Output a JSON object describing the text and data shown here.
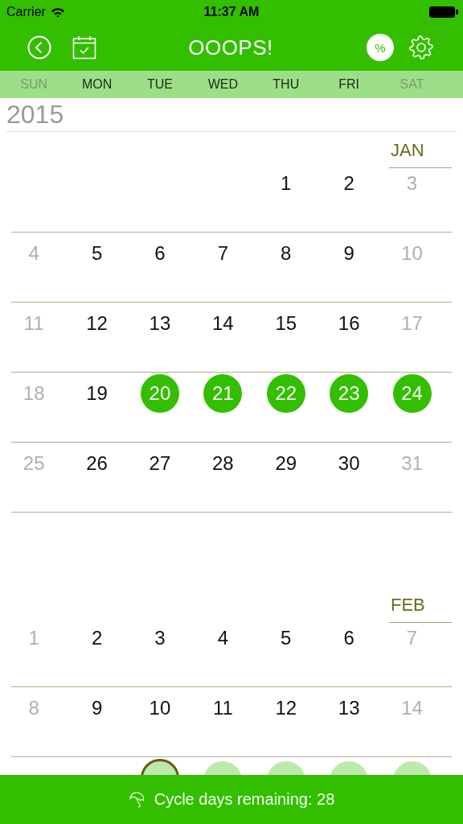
{
  "status_bar": {
    "carrier": "Carrier",
    "time": "11:37 AM"
  },
  "nav": {
    "title": "OOOPS!",
    "badge": "%"
  },
  "weekdays": [
    {
      "label": "SUN",
      "weekend": true
    },
    {
      "label": "MON",
      "weekend": false
    },
    {
      "label": "TUE",
      "weekend": false
    },
    {
      "label": "WED",
      "weekend": false
    },
    {
      "label": "THU",
      "weekend": false
    },
    {
      "label": "FRI",
      "weekend": false
    },
    {
      "label": "SAT",
      "weekend": true
    }
  ],
  "year": "2015",
  "months": [
    {
      "name": "JAN",
      "weeks": [
        [
          {
            "kind": "blank"
          },
          {
            "kind": "blank"
          },
          {
            "kind": "blank"
          },
          {
            "kind": "blank"
          },
          {
            "kind": "day",
            "day": "1",
            "weekend": false
          },
          {
            "kind": "day",
            "day": "2",
            "weekend": false
          },
          {
            "kind": "day",
            "day": "3",
            "weekend": true
          }
        ],
        [
          {
            "kind": "day",
            "day": "4",
            "weekend": true
          },
          {
            "kind": "day",
            "day": "5",
            "weekend": false
          },
          {
            "kind": "day",
            "day": "6",
            "weekend": false
          },
          {
            "kind": "day",
            "day": "7",
            "weekend": false
          },
          {
            "kind": "day",
            "day": "8",
            "weekend": false
          },
          {
            "kind": "day",
            "day": "9",
            "weekend": false
          },
          {
            "kind": "day",
            "day": "10",
            "weekend": true
          }
        ],
        [
          {
            "kind": "day",
            "day": "11",
            "weekend": true
          },
          {
            "kind": "day",
            "day": "12",
            "weekend": false
          },
          {
            "kind": "day",
            "day": "13",
            "weekend": false
          },
          {
            "kind": "day",
            "day": "14",
            "weekend": false
          },
          {
            "kind": "day",
            "day": "15",
            "weekend": false
          },
          {
            "kind": "day",
            "day": "16",
            "weekend": false
          },
          {
            "kind": "day",
            "day": "17",
            "weekend": true
          }
        ],
        [
          {
            "kind": "day",
            "day": "18",
            "weekend": true
          },
          {
            "kind": "day",
            "day": "19",
            "weekend": false
          },
          {
            "kind": "period",
            "day": "20"
          },
          {
            "kind": "period",
            "day": "21"
          },
          {
            "kind": "period",
            "day": "22"
          },
          {
            "kind": "period",
            "day": "23"
          },
          {
            "kind": "period",
            "day": "24"
          }
        ],
        [
          {
            "kind": "day",
            "day": "25",
            "weekend": true
          },
          {
            "kind": "day",
            "day": "26",
            "weekend": false
          },
          {
            "kind": "day",
            "day": "27",
            "weekend": false
          },
          {
            "kind": "day",
            "day": "28",
            "weekend": false
          },
          {
            "kind": "day",
            "day": "29",
            "weekend": false
          },
          {
            "kind": "day",
            "day": "30",
            "weekend": false
          },
          {
            "kind": "day",
            "day": "31",
            "weekend": true
          }
        ]
      ]
    },
    {
      "name": "FEB",
      "weeks": [
        [
          {
            "kind": "day",
            "day": "1",
            "weekend": true
          },
          {
            "kind": "day",
            "day": "2",
            "weekend": false
          },
          {
            "kind": "day",
            "day": "3",
            "weekend": false
          },
          {
            "kind": "day",
            "day": "4",
            "weekend": false
          },
          {
            "kind": "day",
            "day": "5",
            "weekend": false
          },
          {
            "kind": "day",
            "day": "6",
            "weekend": false
          },
          {
            "kind": "day",
            "day": "7",
            "weekend": true
          }
        ],
        [
          {
            "kind": "day",
            "day": "8",
            "weekend": true
          },
          {
            "kind": "day",
            "day": "9",
            "weekend": false
          },
          {
            "kind": "day",
            "day": "10",
            "weekend": false
          },
          {
            "kind": "day",
            "day": "11",
            "weekend": false
          },
          {
            "kind": "day",
            "day": "12",
            "weekend": false
          },
          {
            "kind": "day",
            "day": "13",
            "weekend": false
          },
          {
            "kind": "day",
            "day": "14",
            "weekend": true
          }
        ],
        [
          {
            "kind": "blank"
          },
          {
            "kind": "blank"
          },
          {
            "kind": "today"
          },
          {
            "kind": "predicted"
          },
          {
            "kind": "predicted"
          },
          {
            "kind": "predicted"
          },
          {
            "kind": "predicted"
          }
        ]
      ]
    }
  ],
  "footer": {
    "text": "Cycle days remaining: 28"
  }
}
